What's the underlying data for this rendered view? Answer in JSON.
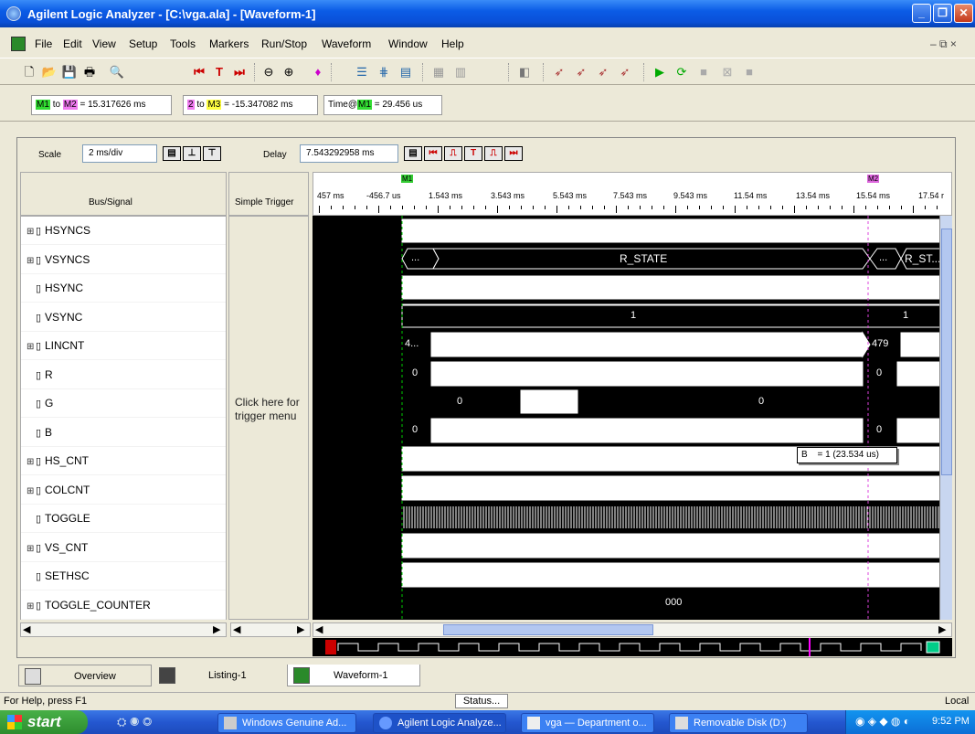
{
  "window": {
    "title": "Agilent Logic Analyzer - [C:\\vga.ala] - [Waveform-1]"
  },
  "menu": [
    "File",
    "Edit",
    "View",
    "Setup",
    "Tools",
    "Markers",
    "Run/Stop",
    "Waveform",
    "Window",
    "Help"
  ],
  "mdi_controls": "– ⧉ ×",
  "markers": {
    "m1_m2": {
      "a": "M1",
      "to": "to",
      "b": "M2",
      "value": "= 15.317626 ms"
    },
    "m2_m3": {
      "a": "2",
      "to": "to",
      "b": "M3",
      "value": "= -15.347082 ms"
    },
    "time_m1": {
      "label": "Time@",
      "m": "M1",
      "value": "= 29.456 us"
    }
  },
  "scale": {
    "label": "Scale",
    "value": "2 ms/div"
  },
  "delay": {
    "label": "Delay",
    "value": "7.543292958 ms"
  },
  "headers": {
    "bus_signal": "Bus/Signal",
    "simple_trigger": "Simple Trigger"
  },
  "time_ticks": [
    "457 ms",
    "-456.7 us",
    "1.543 ms",
    "3.543 ms",
    "5.543 ms",
    "7.543 ms",
    "9.543 ms",
    "11.54 ms",
    "13.54 ms",
    "15.54 ms",
    "17.54 r"
  ],
  "marker_flags": {
    "m1": "M1",
    "m2": "M2"
  },
  "signals": [
    {
      "name": "HSYNCS",
      "expandable": true
    },
    {
      "name": "VSYNCS",
      "expandable": true
    },
    {
      "name": "HSYNC",
      "expandable": false
    },
    {
      "name": "VSYNC",
      "expandable": false
    },
    {
      "name": "LINCNT",
      "expandable": true
    },
    {
      "name": "R",
      "expandable": false
    },
    {
      "name": "G",
      "expandable": false
    },
    {
      "name": "B",
      "expandable": false
    },
    {
      "name": "HS_CNT",
      "expandable": true
    },
    {
      "name": "COLCNT",
      "expandable": true
    },
    {
      "name": "TOGGLE",
      "expandable": false
    },
    {
      "name": "VS_CNT",
      "expandable": true
    },
    {
      "name": "SETHSC",
      "expandable": false
    },
    {
      "name": "TOGGLE_COUNTER",
      "expandable": true
    }
  ],
  "trigger_hint": "Click here for trigger menu",
  "wave_labels": {
    "vsyncs_a": "...",
    "vsyncs_b": "R_STATE",
    "vsyncs_c": "...",
    "vsyncs_d": "R_ST...",
    "vsync_a": "1",
    "vsync_b": "1",
    "lincnt_a": "4...",
    "lincnt_b": "479",
    "r_a": "0",
    "r_b": "0",
    "g_a": "0",
    "g_b": "0",
    "b_a": "0",
    "b_b": "0",
    "toggle_counter": "000"
  },
  "tooltip": {
    "signal": "B",
    "value": "= 1 (23.534 us)"
  },
  "tabs": [
    "Overview",
    "Listing-1",
    "Waveform-1"
  ],
  "status": {
    "help": "For Help, press F1",
    "button": "Status...",
    "mode": "Local"
  },
  "taskbar": {
    "start": "start",
    "tasks": [
      "Windows Genuine Ad...",
      "Agilent Logic Analyze...",
      "vga — Department o...",
      "Removable Disk (D:)"
    ],
    "clock": "9:52 PM"
  }
}
